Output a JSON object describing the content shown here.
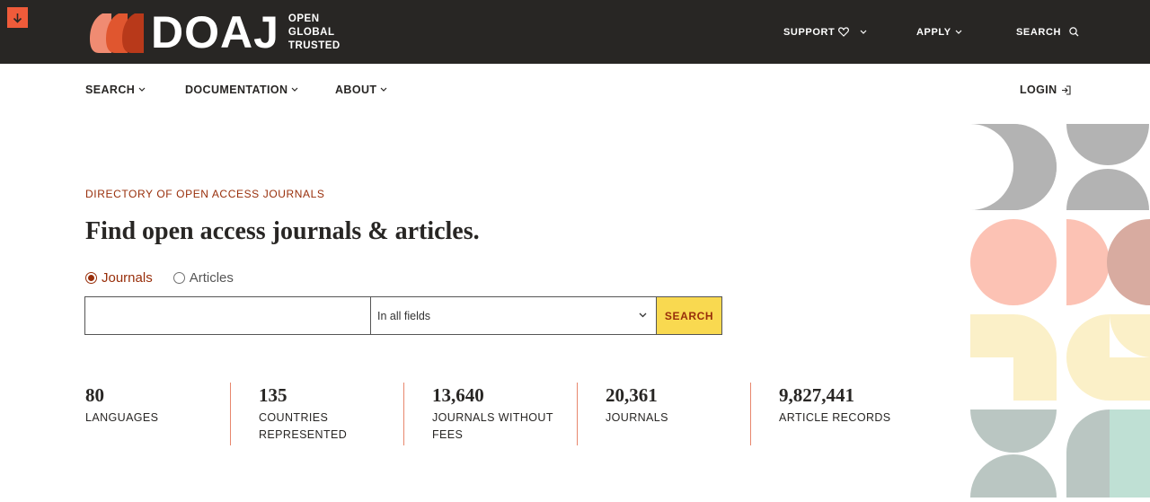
{
  "header": {
    "logo_word": "DOAJ",
    "tagline": [
      "OPEN",
      "GLOBAL",
      "TRUSTED"
    ],
    "nav": [
      {
        "label": "SUPPORT",
        "icon": "heart-icon"
      },
      {
        "label": "APPLY",
        "icon": "chevron-down-icon"
      },
      {
        "label": "SEARCH",
        "icon": "search-icon"
      }
    ]
  },
  "subnav": {
    "items": [
      "SEARCH",
      "DOCUMENTATION",
      "ABOUT"
    ],
    "login": "LOGIN"
  },
  "hero": {
    "eyebrow": "DIRECTORY OF OPEN ACCESS JOURNALS",
    "headline": "Find open access journals & articles.",
    "radios": [
      {
        "label": "Journals",
        "checked": true
      },
      {
        "label": "Articles",
        "checked": false
      }
    ],
    "search": {
      "input_value": "",
      "field_selected": "In all fields",
      "button": "SEARCH"
    }
  },
  "stats": [
    {
      "value": "80",
      "label": "LANGUAGES"
    },
    {
      "value": "135",
      "label": "COUNTRIES REPRESENTED"
    },
    {
      "value": "13,640",
      "label": "JOURNALS WITHOUT FEES"
    },
    {
      "value": "20,361",
      "label": "JOURNALS"
    },
    {
      "value": "9,827,441",
      "label": "ARTICLE RECORDS"
    }
  ],
  "colors": {
    "dark": "#282624",
    "accent_orange": "#ef5b3a",
    "accent_red": "#982e0a",
    "yellow": "#f9d950",
    "separator": "#e8876d"
  }
}
